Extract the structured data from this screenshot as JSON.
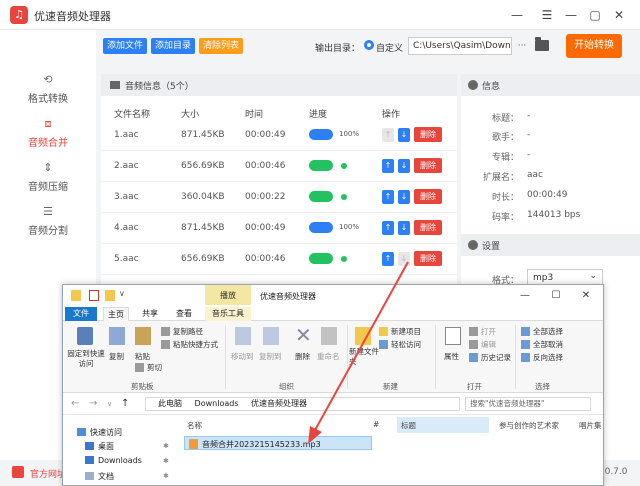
{
  "app": {
    "title": "优速音频处理器",
    "logo_glyph": "♫"
  },
  "window_controls": [
    "—",
    "☰",
    "—",
    "▢",
    "✕"
  ],
  "sidebar": {
    "items": [
      {
        "label": "格式转换",
        "icon": "refresh-icon",
        "glyph": "⟲",
        "active": false
      },
      {
        "label": "音频合并",
        "icon": "merge-icon",
        "glyph": "⧈",
        "active": true
      },
      {
        "label": "音频压缩",
        "icon": "compress-icon",
        "glyph": "⇕",
        "active": false
      },
      {
        "label": "音频分割",
        "icon": "split-icon",
        "glyph": "☰",
        "active": false
      }
    ]
  },
  "toolbar": {
    "add_file": "添加文件",
    "add_folder": "添加目录",
    "clear_list": "清除列表",
    "output_label": "输出目录：",
    "custom_label": "自定义",
    "output_path": "C:\\Users\\Qasim\\Downl",
    "more": "···",
    "start": "开始转换"
  },
  "colors": {
    "accent_red": "#e8453c",
    "blue": "#2d7ff5",
    "green": "#23c160",
    "orange": "#ff6a00",
    "add_btn": "#2d7ff5",
    "clear_btn": "#ff9d1a"
  },
  "files": {
    "header": "音频信息（5个）",
    "columns": [
      "文件名称",
      "大小",
      "时间",
      "进度",
      "操作"
    ],
    "rows": [
      {
        "name": "1.aac",
        "size": "871.45KB",
        "time": "00:00:49",
        "progress": 1.0,
        "bar": "blue",
        "status": "100%",
        "up_disabled": true,
        "down_disabled": false,
        "delete": "删除"
      },
      {
        "name": "2.aac",
        "size": "656.69KB",
        "time": "00:00:46",
        "progress": 1.0,
        "bar": "green",
        "status": "",
        "up_disabled": false,
        "down_disabled": false,
        "delete": "删除"
      },
      {
        "name": "3.aac",
        "size": "360.04KB",
        "time": "00:00:22",
        "progress": 1.0,
        "bar": "green",
        "status": "",
        "up_disabled": false,
        "down_disabled": false,
        "delete": "删除"
      },
      {
        "name": "4.aac",
        "size": "871.45KB",
        "time": "00:00:49",
        "progress": 1.0,
        "bar": "blue",
        "status": "100%",
        "up_disabled": false,
        "down_disabled": false,
        "delete": "删除"
      },
      {
        "name": "5.aac",
        "size": "656.69KB",
        "time": "00:00:46",
        "progress": 1.0,
        "bar": "green",
        "status": "",
        "up_disabled": false,
        "down_disabled": true,
        "delete": "删除"
      }
    ]
  },
  "info": {
    "header": "信息",
    "fields": [
      {
        "label": "标题：",
        "value": "-"
      },
      {
        "label": "歌手：",
        "value": "-"
      },
      {
        "label": "专辑：",
        "value": "-"
      },
      {
        "label": "扩展名：",
        "value": "aac"
      },
      {
        "label": "时长：",
        "value": "00:00:49"
      },
      {
        "label": "码率：",
        "value": "144013 bps"
      }
    ],
    "settings_header": "设置",
    "format_label": "格式：",
    "format_value": "mp3",
    "format_arrow": "⌄"
  },
  "footer": {
    "site": "官方网址",
    "version": "2.0.7.0"
  },
  "explorer": {
    "context_tab": "播放",
    "title": "优速音频处理器",
    "tabs": [
      "文件",
      "主页",
      "共享",
      "查看",
      "音乐工具"
    ],
    "controls": [
      "—",
      "☐",
      "✕"
    ],
    "ribbon": {
      "pin": "固定到快速访问",
      "copy": "复制",
      "paste": "粘贴",
      "copy_path": "复制路径",
      "paste_shortcut": "粘贴快捷方式",
      "cut": "剪切",
      "clipboard": "剪贴板",
      "move_to": "移动到",
      "copy_to": "复制到",
      "delete": "删除",
      "rename": "重命名",
      "organize": "组织",
      "new_folder": "新建文件夹",
      "new_item": "新建项目",
      "easy_access": "轻松访问",
      "new_group": "新建",
      "properties": "属性",
      "open": "打开",
      "edit": "编辑",
      "history": "历史记录",
      "open_group": "打开",
      "select_all": "全部选择",
      "select_none": "全部取消",
      "invert": "反向选择",
      "select_group": "选择"
    },
    "address": {
      "back": "←",
      "forward": "→",
      "recent": "∨",
      "up": "↑",
      "path": [
        "此电脑",
        "Downloads",
        "优速音频处理器"
      ],
      "search_placeholder": "搜索\"优速音频处理器\""
    },
    "nav": [
      {
        "label": "快速访问",
        "icon": "star-icon"
      },
      {
        "label": "桌面",
        "icon": "desktop-icon"
      },
      {
        "label": "Downloads",
        "icon": "download-icon"
      },
      {
        "label": "文档",
        "icon": "document-icon"
      }
    ],
    "list_headers": {
      "name": "名称",
      "num": "#",
      "title": "标题",
      "artist": "参与创作的艺术家",
      "album": "唱片集"
    },
    "file": "音频合并2023215145233.mp3"
  }
}
